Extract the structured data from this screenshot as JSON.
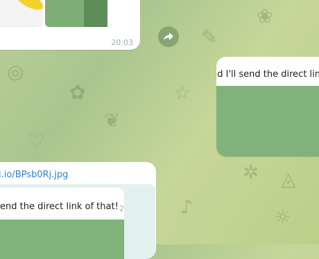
{
  "messages": {
    "top": {
      "time": "20:03"
    },
    "right": {
      "text": "nd I'll send the direct link"
    },
    "bottom": {
      "link": "i.io/BPsb0Rj.jpg",
      "quoted_text": "end the direct link of that!",
      "partial_time": "2"
    }
  },
  "icons": {
    "share": "share-forward-icon"
  },
  "colors": {
    "bubble": "#ffffff",
    "link": "#2b83c6",
    "timestamp": "#9fb1a0",
    "image_green": "#7fb37b"
  }
}
